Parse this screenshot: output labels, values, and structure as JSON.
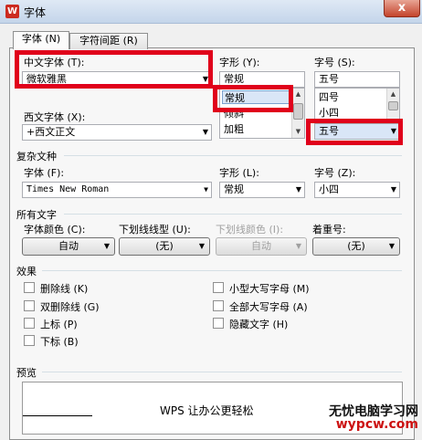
{
  "window": {
    "title": "字体",
    "icon": "wps-writer-icon",
    "close_label": "x"
  },
  "tabs": [
    {
      "label": "字体 (N)",
      "active": true
    },
    {
      "label": "字符间距 (R)",
      "active": false
    }
  ],
  "chinese_font": {
    "label": "中文字体 (T):",
    "value": "微软雅黑"
  },
  "western_font": {
    "label": "西文字体 (X):",
    "value": "+西文正文"
  },
  "style": {
    "label": "字形 (Y):",
    "value": "常规",
    "options": [
      "常规",
      "倾斜",
      "加粗"
    ],
    "selected": "常规"
  },
  "size": {
    "label": "字号 (S):",
    "value": "五号",
    "options": [
      "四号",
      "小四",
      "五号"
    ],
    "selected": "五号"
  },
  "complex": {
    "section": "复杂文种",
    "font_label": "字体 (F):",
    "font_value": "Times New Roman",
    "style_label": "字形 (L):",
    "style_value": "常规",
    "size_label": "字号 (Z):",
    "size_value": "小四"
  },
  "all_text": {
    "section": "所有文字",
    "color_label": "字体颜色 (C):",
    "color_value": "自动",
    "underline_label": "下划线线型 (U):",
    "underline_value": "(无)",
    "underline_color_label": "下划线颜色 (I):",
    "underline_color_value": "自动",
    "emphasis_label": "着重号:",
    "emphasis_value": "(无)"
  },
  "effects": {
    "section": "效果",
    "left": [
      "删除线 (K)",
      "双删除线 (G)",
      "上标 (P)",
      "下标 (B)"
    ],
    "right": [
      "小型大写字母 (M)",
      "全部大写字母 (A)",
      "隐藏文字 (H)"
    ]
  },
  "preview": {
    "section": "预览",
    "text": "WPS 让办公更轻松"
  },
  "watermark": {
    "line1": "无忧电脑学习网",
    "line2": "wypcw.com"
  },
  "colors": {
    "highlight": "#e0001b",
    "selection": "#d9e6f7"
  }
}
